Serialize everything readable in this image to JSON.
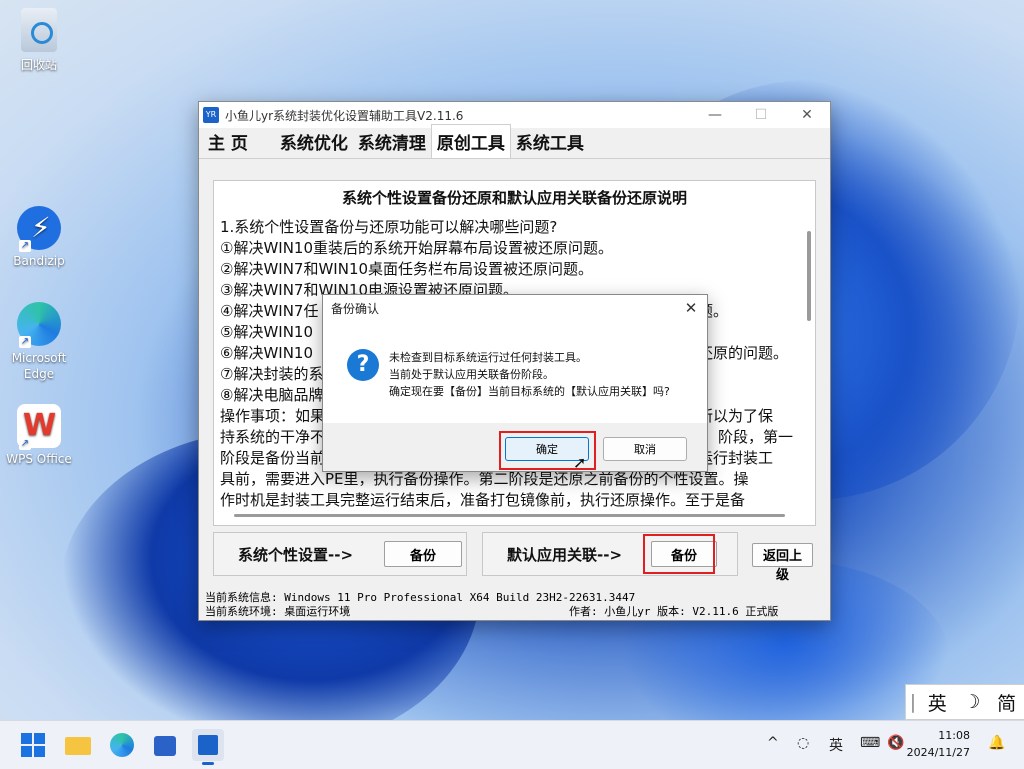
{
  "desktop": {
    "icons": [
      {
        "label": "回收站"
      },
      {
        "label": "Bandizip"
      },
      {
        "label": "Microsoft Edge"
      },
      {
        "label": "WPS Office"
      }
    ]
  },
  "window": {
    "title": "小鱼儿yr系统封装优化设置辅助工具V2.11.6",
    "logo_text": "YR",
    "controls": {
      "minimize": "—",
      "maximize": "☐",
      "close": "✕"
    },
    "tabs": [
      "主 页",
      "系统优化",
      "系统清理",
      "原创工具",
      "系统工具"
    ],
    "active_tab": 3,
    "panel_title": "系统个性设置备份还原和默认应用关联备份还原说明",
    "lines": [
      "1.系统个性设置备份与还原功能可以解决哪些问题?",
      "①解决WIN10重装后的系统开始屏幕布局设置被还原问题。",
      "②解决WIN7和WIN10桌面任务栏布局设置被还原问题。",
      "③解决WIN7和WIN10电源设置被还原问题。",
      "④解决WIN7任",
      "⑤解决WIN10",
      "⑥解决WIN10",
      "⑦解决封装的系",
      "⑧解决电脑品牌",
      "操作事项：如果",
      "持系统的干净不",
      "阶段是备份当前",
      "具前，需要进入PE里，执行备份操作。第二阶段是还原之前备份的个性设置。操",
      "作时机是封装工具完整运行结束后，准备打包镜像前，执行还原操作。至于是备"
    ],
    "right_fragments": [
      {
        "text": "题。",
        "line": 4
      },
      {
        "text": "还原的问题。",
        "line": 6
      },
      {
        "text": "所以为了保",
        "line": 10
      },
      {
        "text": "阶段，第一",
        "line": 11
      },
      {
        "text": "运行封装工",
        "line": 12
      }
    ],
    "group1": {
      "label": "系统个性设置-->",
      "button": "备份"
    },
    "group2": {
      "label": "默认应用关联-->",
      "button": "备份"
    },
    "back_button": "返回上级",
    "status1": "当前系统信息: Windows 11 Pro Professional X64 Build 23H2-22631.3447",
    "status2_left": "当前系统环境: 桌面运行环境",
    "status2_right": "作者: 小鱼儿yr   版本: V2.11.6 正式版"
  },
  "dialog": {
    "title": "备份确认",
    "close": "✕",
    "icon": "question-icon",
    "messages": [
      "未检查到目标系统运行过任何封装工具。",
      "当前处于默认应用关联备份阶段。",
      "确定现在要【备份】当前目标系统的【默认应用关联】吗?"
    ],
    "ok": "确定",
    "cancel": "取消"
  },
  "ime": {
    "lang": "英",
    "mode": "简",
    "moon": "☽",
    "sep": "|"
  },
  "taskbar": {
    "tray_lang": "英",
    "time": "11:08",
    "date": "2024/11/27",
    "chevron": "^"
  },
  "colors": {
    "accent": "#1b62c9",
    "highlight": "#e02020"
  }
}
